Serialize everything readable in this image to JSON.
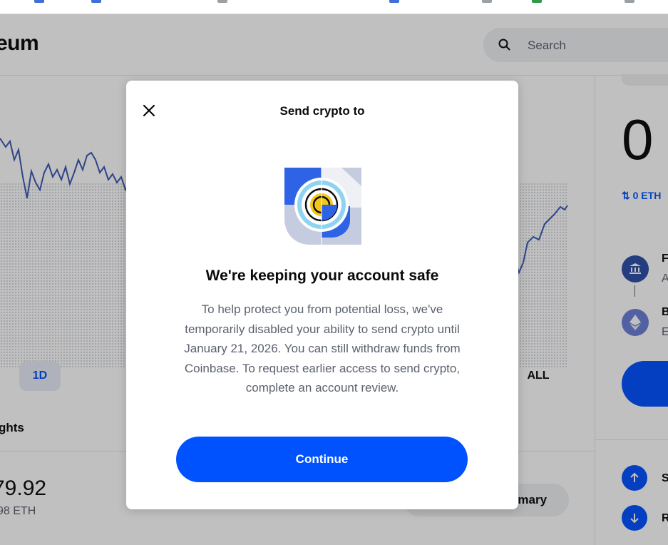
{
  "page": {
    "title": "eum",
    "search": {
      "placeholder": "Search",
      "icon": "search-icon"
    },
    "chart": {
      "series_color": "#3b58b5",
      "ranges": [
        {
          "label": "1D",
          "active": true
        },
        {
          "label": "ALL",
          "active": false
        }
      ]
    },
    "highlights_label": "ghts",
    "balance": {
      "fiat": "79.92",
      "crypto": "98 ETH"
    },
    "summary_button": "nmary"
  },
  "right_panel": {
    "big_value": "0",
    "eth_amount": "0 ETH",
    "rows": [
      {
        "title": "F",
        "subtitle": "A",
        "icon": "bank-icon"
      },
      {
        "title": "B",
        "subtitle": "E",
        "icon": "ethereum-icon"
      }
    ],
    "actions": [
      {
        "label": "S",
        "icon": "arrow-up-icon"
      },
      {
        "label": "R",
        "icon": "arrow-down-icon"
      }
    ]
  },
  "modal": {
    "title": "Send crypto to",
    "close_icon": "close-icon",
    "illustration": "shield-lock-illustration",
    "heading": "We're keeping your account safe",
    "body": "To help protect you from potential loss, we've temporarily disabled your ability to send crypto until January 21, 2026. You can still withdraw funds from Coinbase. To request earlier access to send crypto, complete an account review.",
    "button": "Continue"
  },
  "colors": {
    "brand": "#0052ff",
    "text_primary": "#0a0b0d",
    "text_secondary": "#5b616e",
    "overlay": "rgba(10,11,13,0.26)"
  }
}
